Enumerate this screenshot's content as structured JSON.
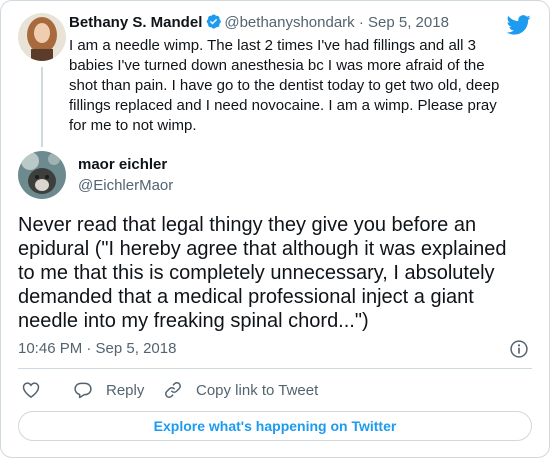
{
  "colors": {
    "accent": "#1d9bf0",
    "text": "#0f1419",
    "muted": "#536471",
    "border": "#cfd9de"
  },
  "icons": {
    "brand": "twitter-bird-icon",
    "verified": "verified-badge-icon",
    "info": "info-icon",
    "like": "heart-icon",
    "reply": "reply-bubble-icon",
    "copy": "link-icon"
  },
  "parent_tweet": {
    "name": "Bethany S. Mandel",
    "handle": "@bethanyshondark",
    "separator": "·",
    "date": "Sep 5, 2018",
    "text": "I am a needle wimp. The last 2 times I've had fillings and all 3 babies I've turned down anesthesia bc I was more afraid of the shot than pain. I have go to the dentist today to get two old, deep fillings replaced and I need novocaine. I am a wimp. Please pray for me to not wimp."
  },
  "tweet": {
    "name": "maor eichler",
    "handle": "@EichlerMaor",
    "text": "Never read that legal thingy they give you before an epidural (\"I hereby agree that although it was explained to me that this is completely unnecessary, I absolutely demanded that a medical professional inject a giant needle into my freaking spinal chord...\")",
    "time": "10:46 PM · Sep 5, 2018"
  },
  "actions": {
    "reply_label": "Reply",
    "copy_label": "Copy link to Tweet"
  },
  "footer": {
    "explore_label": "Explore what's happening on Twitter"
  }
}
